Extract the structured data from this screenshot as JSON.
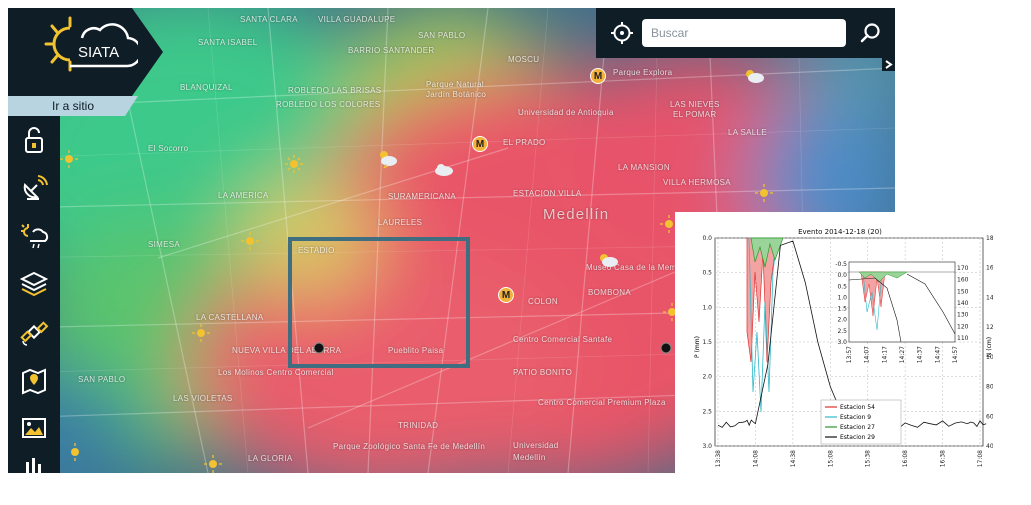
{
  "app": {
    "logo_text": "SIATA",
    "goto_site_label": "Ir a sitio"
  },
  "search": {
    "placeholder": "Buscar"
  },
  "sidebar": {
    "items": [
      {
        "icon": "lock-icon"
      },
      {
        "icon": "satellite-dish-icon"
      },
      {
        "icon": "weather-icon"
      },
      {
        "icon": "layers-icon"
      },
      {
        "icon": "satellite-icon"
      },
      {
        "icon": "map-pin-icon"
      },
      {
        "icon": "image-gallery-icon"
      },
      {
        "icon": "chart-icon"
      }
    ]
  },
  "map": {
    "labels": [
      "SANTA CLARA",
      "VILLA GUADALUPE",
      "SANTA ISABEL",
      "SAN PABLO",
      "BARRIO SANTANDER",
      "MOSCU",
      "Parque Explora",
      "BLANQUIZAL",
      "ROBLEDO LAS BRISAS",
      "ROBLEDO LOS COLORES",
      "Parque Natural",
      "Jardín Botánico",
      "Universidad de Antioquia",
      "LAS NIEVES",
      "EL POMAR",
      "LA SALLE",
      "EL PRADO",
      "El Socorro",
      "SURAMERICANA",
      "ESTACION VILLA",
      "LA MANSION",
      "VILLA HERMOSA",
      "LA AMERICA",
      "Medellín",
      "LAURELES",
      "ESTADIO",
      "SIMESA",
      "Museo Casa de la Memoria",
      "BOMBONA",
      "LA CASTELLANA",
      "COLON",
      "NUEVA VILLA DEL ABURRA",
      "Pueblito Paisa",
      "Centro Comercial Santafe",
      "Los Molinos Centro Comercial",
      "LAS VIOLETAS",
      "SAN PABLO",
      "PATIO BONITO",
      "Centro Comercial Premium Plaza",
      "TRINIDAD",
      "Parque Zoológico Santa Fe de Medellín",
      "LA GLORIA",
      "Universidad",
      "Medellín"
    ],
    "station_badge": "M"
  },
  "colors": {
    "panel_dark": "#0f1d26",
    "accent_light_blue": "#b7d4e0",
    "selection_box": "#3f6e80",
    "sun_yellow": "#f2c230"
  },
  "chart_data": {
    "type": "area",
    "title": "Evento 2014-12-18 (20)",
    "xlabel": "",
    "ylabel": "P (mm)",
    "y2label": "N (cm)",
    "x_ticks": [
      "13:38",
      "14:08",
      "14:38",
      "15:08",
      "15:38",
      "16:08",
      "16:38",
      "17:08"
    ],
    "y_ticks": [
      "0.0",
      "0.5",
      "1.0",
      "1.5",
      "2.0",
      "2.5",
      "3.0"
    ],
    "y2_ticks": [
      "40",
      "60",
      "80",
      "100",
      "120",
      "140",
      "160",
      "180"
    ],
    "ylim": [
      0,
      3
    ],
    "y2lim": [
      40,
      180
    ],
    "y_inverted": true,
    "inset": {
      "x_ticks": [
        "13:57",
        "14:07",
        "14:17",
        "14:27",
        "14:37",
        "14:47",
        "14:57"
      ],
      "y_ticks": [
        "-0.5",
        "0.0",
        "0.5",
        "1.0",
        "1.5",
        "2.0",
        "2.5",
        "3.0"
      ],
      "y2_ticks": [
        "110",
        "120",
        "130",
        "140",
        "150",
        "160",
        "170"
      ]
    },
    "legend_position": "lower-right",
    "series": [
      {
        "name": "Estacion 54",
        "color": "#e03030"
      },
      {
        "name": "Estacion 9",
        "color": "#30b8c8"
      },
      {
        "name": "Estacion 27",
        "color": "#2a9a2a"
      },
      {
        "name": "Estacion 29",
        "color": "#111111"
      }
    ],
    "level_series": {
      "name": "Estacion 29",
      "x": [
        "13:38",
        "13:58",
        "14:08",
        "14:18",
        "14:28",
        "14:38",
        "14:48",
        "14:58",
        "15:08",
        "15:18",
        "15:28",
        "15:38",
        "15:58",
        "16:28",
        "16:58",
        "17:13"
      ],
      "y": [
        54,
        56,
        55,
        95,
        175,
        178,
        150,
        110,
        80,
        60,
        54,
        53,
        54,
        55,
        55,
        55
      ]
    }
  }
}
